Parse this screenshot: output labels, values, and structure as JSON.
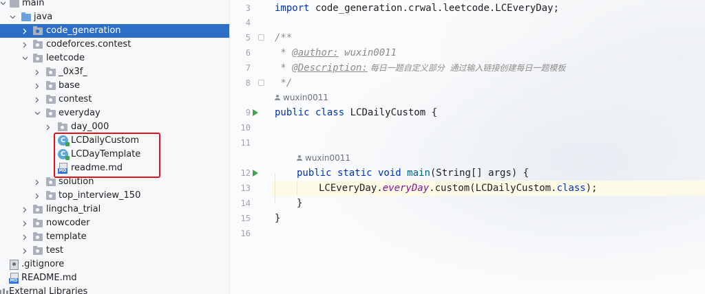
{
  "project_tree": {
    "items": [
      {
        "label": "main",
        "icon": "folder-icon",
        "expanded": true
      },
      {
        "label": "java",
        "icon": "source-folder-icon",
        "expanded": true
      },
      {
        "label": "code_generation",
        "icon": "package-icon",
        "expanded": false,
        "selected": true
      },
      {
        "label": "codeforces.contest",
        "icon": "package-icon",
        "expanded": false
      },
      {
        "label": "leetcode",
        "icon": "package-icon",
        "expanded": true
      },
      {
        "label": "_0x3f_",
        "icon": "package-icon",
        "expanded": false
      },
      {
        "label": "base",
        "icon": "package-icon",
        "expanded": false
      },
      {
        "label": "contest",
        "icon": "package-icon",
        "expanded": false
      },
      {
        "label": "everyday",
        "icon": "package-icon",
        "expanded": true
      },
      {
        "label": "day_000",
        "icon": "package-icon",
        "expanded": false
      },
      {
        "label": "LCDailyCustom",
        "icon": "java-class-icon"
      },
      {
        "label": "LCDayTemplate",
        "icon": "java-class-icon"
      },
      {
        "label": "readme.md",
        "icon": "markdown-file-icon"
      },
      {
        "label": "solution",
        "icon": "package-icon",
        "expanded": false
      },
      {
        "label": "top_interview_150",
        "icon": "package-icon",
        "expanded": false
      },
      {
        "label": "lingcha_trial",
        "icon": "package-icon",
        "expanded": false
      },
      {
        "label": "nowcoder",
        "icon": "package-icon",
        "expanded": false
      },
      {
        "label": "template",
        "icon": "package-icon",
        "expanded": false
      },
      {
        "label": "test",
        "icon": "package-icon",
        "expanded": false
      },
      {
        "label": ".gitignore",
        "icon": "gitignore-file-icon"
      },
      {
        "label": "README.md",
        "icon": "markdown-file-icon"
      },
      {
        "label": "External Libraries",
        "icon": "library-icon"
      }
    ],
    "highlight_color": "#e4101d",
    "selection_color": "#2d6fc6"
  },
  "editor": {
    "line_numbers": [
      "3",
      "4",
      "5",
      "6",
      "7",
      "8",
      "9",
      "10",
      "11",
      "12",
      "13",
      "14",
      "15",
      "16"
    ],
    "code": {
      "l3_kw": "import",
      "l3_rest": " code_generation.crwal.leetcode.LCEveryDay;",
      "l5": "/**",
      "l6_star": " * ",
      "l6_tag": "@author:",
      "l6_val": " wuxin0011",
      "l7_star": " * ",
      "l7_tag": "@Description:",
      "l7_val": " 每日一题自定义部分  通过输入链接创建每日一题模板",
      "l8": " */",
      "l9_kw": "public class",
      "l9_rest": " LCDailyCustom {",
      "l12_kw": "public static void",
      "l12_method": "main",
      "l12_rest": "(String[] args) {",
      "l13_a": "LCEveryDay.",
      "l13_b": "everyDay",
      "l13_c": ".custom(LCDailyCustom.",
      "l13_d": "class",
      "l13_e": ");",
      "l14": "}",
      "l15": "}"
    },
    "author_hints": [
      "wuxin0011",
      "wuxin0011"
    ]
  }
}
